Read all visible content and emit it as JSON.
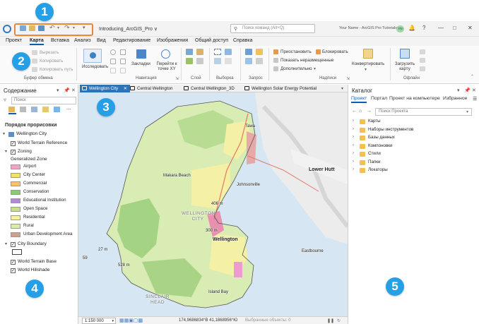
{
  "callouts": [
    "1",
    "2",
    "3",
    "4",
    "5"
  ],
  "titlebar": {
    "project_title": "Introducing_ArcGIS_Pro ∨",
    "command_search_placeholder": "Поиск команд (Alt+Q)",
    "user_name": "Your Name - ArcGIS Pro Tutorials",
    "user_initials": "YN",
    "help": "?",
    "minimize": "—",
    "maximize": "□",
    "close": "✕"
  },
  "ribbon_tabs": [
    "Проект",
    "Карта",
    "Вставка",
    "Анализ",
    "Вид",
    "Редактирование",
    "Изображения",
    "Общий доступ",
    "Справка"
  ],
  "active_ribbon_tab": "Карта",
  "ribbon": {
    "clipboard": {
      "cut": "Вырезать",
      "copy": "Копировать",
      "copy_path": "Копировать путь",
      "group": "Буфер обмена"
    },
    "navigate": {
      "explore": "Исследовать",
      "bookmarks": "Закладки",
      "goto_xy": "Перейти к точке XY",
      "group": "Навигация"
    },
    "layer": {
      "group": "Слой"
    },
    "selection": {
      "group": "Выборка"
    },
    "inquiry": {
      "group": "Запрос"
    },
    "labeling": {
      "pause": "Приостановить",
      "lock": "Блокировать",
      "view_unplaced": "Показать неразмещенные",
      "more": "Дополнительно",
      "group": "Надписи"
    },
    "convert": {
      "label": "Конвертировать"
    },
    "offline": {
      "download_map": "Загрузить карту",
      "group": "Офлайн"
    }
  },
  "toc": {
    "title": "Содержание",
    "search_placeholder": "Поиск",
    "drawing_order": "Порядок прорисовки",
    "map_name": "Wellington City",
    "layers": [
      {
        "name": "World Terrain Reference",
        "checked": true
      },
      {
        "name": "Zoning",
        "checked": true
      },
      {
        "name": "City Boundary",
        "checked": true
      },
      {
        "name": "World Terrain Base",
        "checked": true
      },
      {
        "name": "World Hillshade",
        "checked": true
      }
    ],
    "zoning_field": "Generalized Zone",
    "zoning_classes": [
      {
        "label": "Airport",
        "color": "#f2a3c6"
      },
      {
        "label": "City Center",
        "color": "#f5e06a"
      },
      {
        "label": "Commercial",
        "color": "#f7c46a"
      },
      {
        "label": "Conservation",
        "color": "#8cc975"
      },
      {
        "label": "Educational Institution",
        "color": "#b18bd1"
      },
      {
        "label": "Open Space",
        "color": "#c5df92"
      },
      {
        "label": "Residential",
        "color": "#f6f2a2"
      },
      {
        "label": "Rural",
        "color": "#d9ecb0"
      },
      {
        "label": "Urban Development Area",
        "color": "#c9a390"
      }
    ]
  },
  "map": {
    "tabs": [
      "Wellington City",
      "Central Wellington",
      "Central Wellington_3D",
      "Wellington Solar Energy Potential"
    ],
    "active_tab": "Wellington City",
    "labels": {
      "tawa": "Tawa",
      "lower_hutt": "Lower Hutt",
      "makara": "Makara Beach",
      "johnsonville": "Johnsonville",
      "wellington": "Wellington",
      "wellington_city": "WELLINGTON CITY",
      "eastbourne": "Eastbourne",
      "island_bay": "Island Bay",
      "sinclair": "SINCLAIR HEAD",
      "h406": "406 m",
      "h300": "300 m",
      "h27": "27 m",
      "h528": "528 m",
      "h59": "59"
    },
    "status": {
      "scale": "1:150 000",
      "coordinates": "174,9686834°В 41,1868956°Ю",
      "selected_features": "Выбранные объекты: 0"
    }
  },
  "catalog": {
    "title": "Каталог",
    "tabs": [
      "Проект",
      "Портал",
      "Проект на компьютере",
      "Избранное"
    ],
    "active_tab": "Проект",
    "search_placeholder": "Поиск Проекта",
    "items": [
      "Карты",
      "Наборы инструментов",
      "Базы данных",
      "Компоновки",
      "Стили",
      "Папки",
      "Локаторы"
    ]
  }
}
